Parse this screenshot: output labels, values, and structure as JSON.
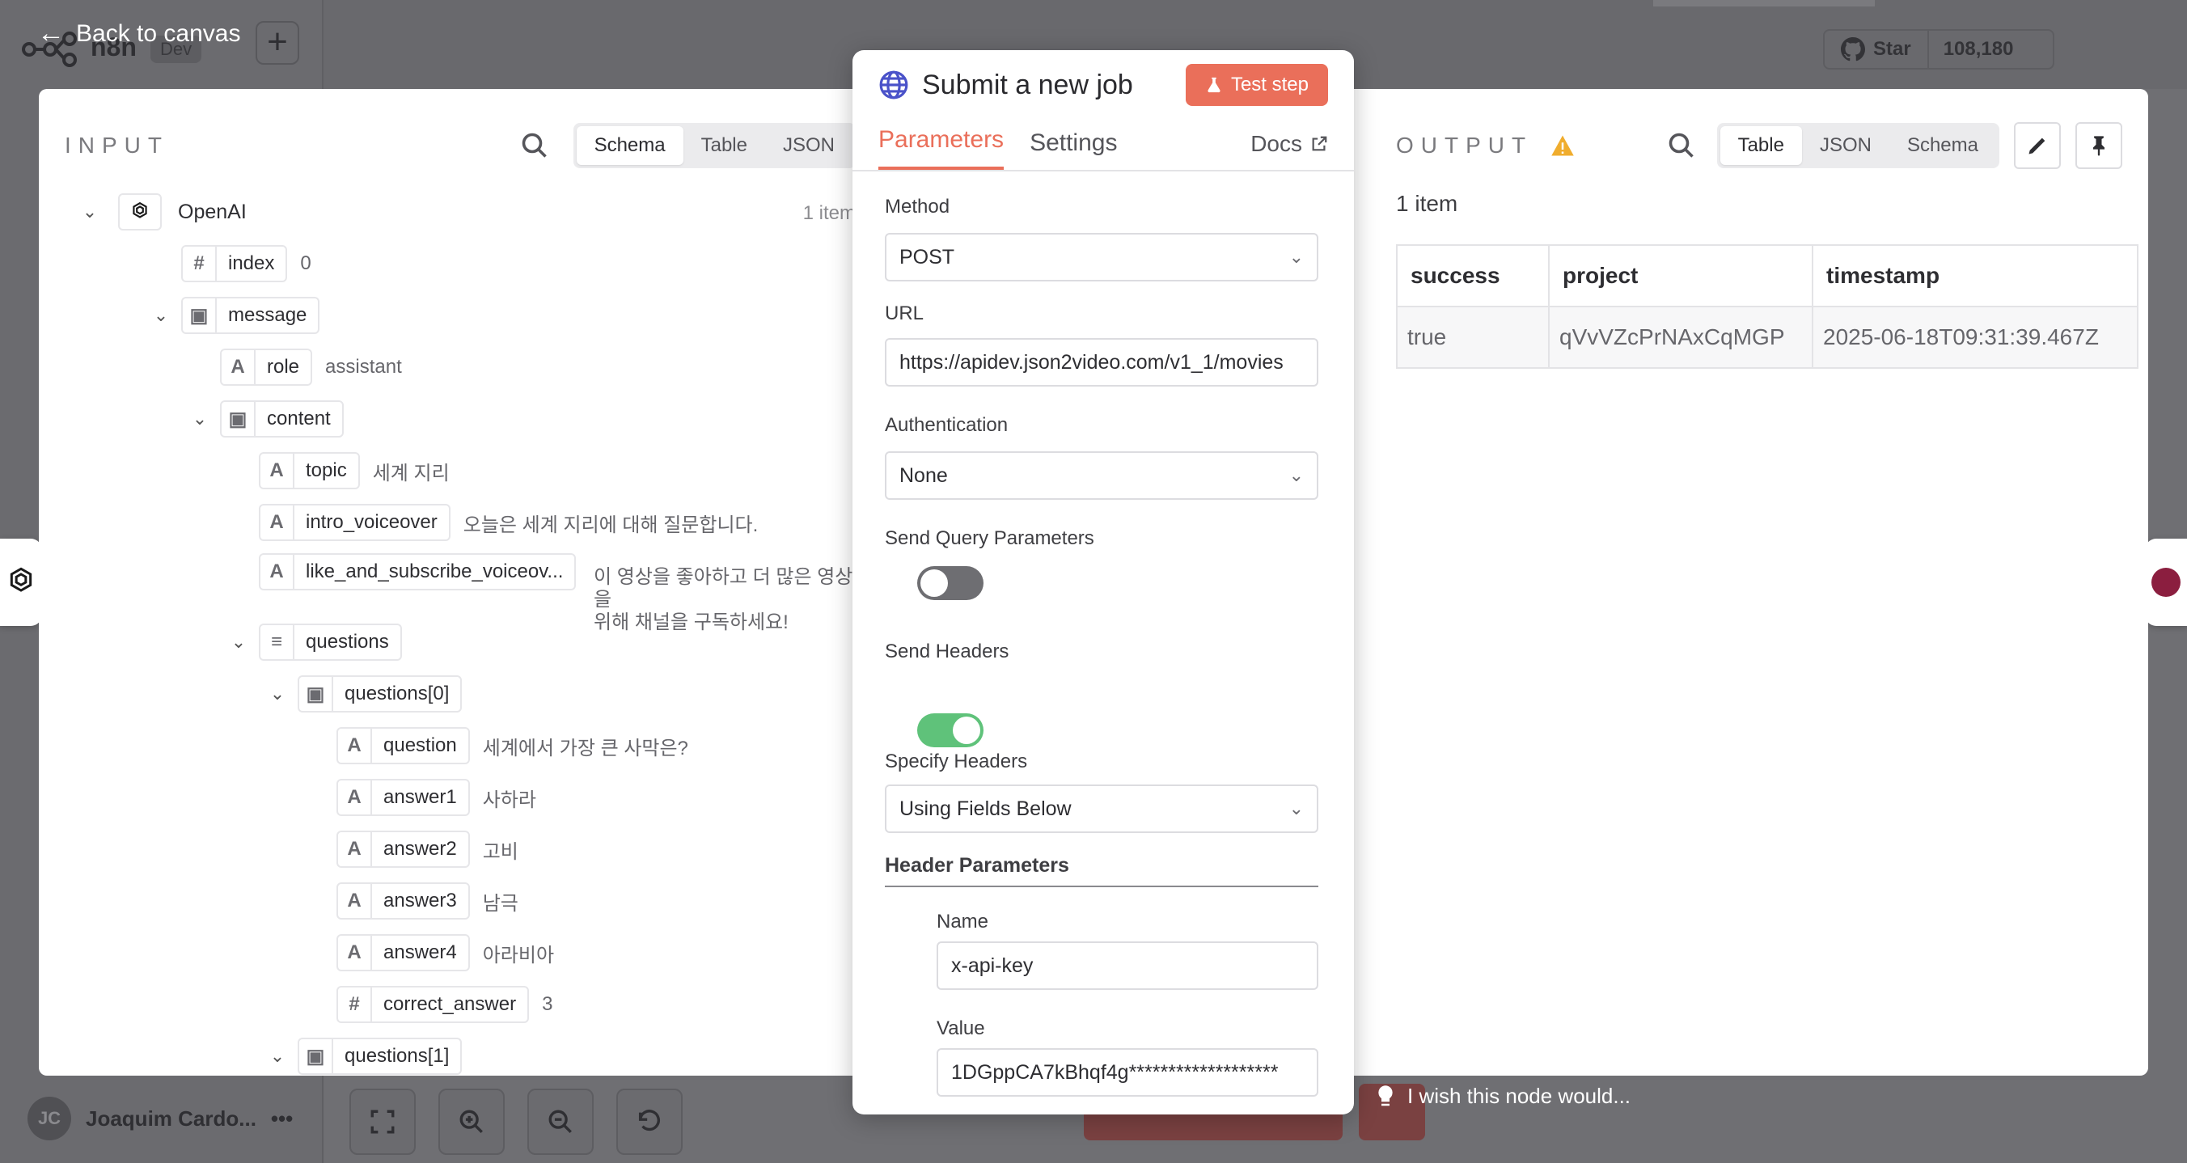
{
  "background": {
    "app_name": "n8n",
    "env_badge": "Dev",
    "github_star": "Star",
    "github_count": "108,180",
    "user_initials": "JC",
    "user_name": "Joaquim Cardo...",
    "user_menu": "•••"
  },
  "back_link": "Back to canvas",
  "input": {
    "title": "INPUT",
    "views": [
      "Schema",
      "Table",
      "JSON"
    ],
    "active_view": "Schema",
    "tree": {
      "root": {
        "name": "OpenAI",
        "count": "1 item"
      },
      "index": {
        "type": "#",
        "name": "index",
        "value": "0"
      },
      "message": {
        "name": "message"
      },
      "role": {
        "type": "A",
        "name": "role",
        "value": "assistant"
      },
      "content": {
        "name": "content"
      },
      "topic": {
        "type": "A",
        "name": "topic",
        "value": "세계 지리"
      },
      "intro": {
        "type": "A",
        "name": "intro_voiceover",
        "value": "오늘은 세계 지리에 대해 질문합니다."
      },
      "like": {
        "type": "A",
        "name": "like_and_subscribe_voiceov...",
        "value_line1": "이 영상을 좋아하고 더 많은 영상을",
        "value_line2": "위해 채널을 구독하세요!"
      },
      "questions": {
        "name": "questions"
      },
      "q0": {
        "name": "questions[0]"
      },
      "question": {
        "type": "A",
        "name": "question",
        "value": "세계에서 가장 큰 사막은?"
      },
      "answer1": {
        "type": "A",
        "name": "answer1",
        "value": "사하라"
      },
      "answer2": {
        "type": "A",
        "name": "answer2",
        "value": "고비"
      },
      "answer3": {
        "type": "A",
        "name": "answer3",
        "value": "남극"
      },
      "answer4": {
        "type": "A",
        "name": "answer4",
        "value": "아라비아"
      },
      "correct": {
        "type": "#",
        "name": "correct_answer",
        "value": "3"
      },
      "q1": {
        "name": "questions[1]"
      }
    }
  },
  "node": {
    "title": "Submit a new job",
    "test_button": "Test step",
    "tabs": {
      "parameters": "Parameters",
      "settings": "Settings",
      "docs": "Docs"
    },
    "method": {
      "label": "Method",
      "value": "POST"
    },
    "url": {
      "label": "URL",
      "value": "https://apidev.json2video.com/v1_1/movies"
    },
    "authentication": {
      "label": "Authentication",
      "value": "None"
    },
    "send_query": {
      "label": "Send Query Parameters",
      "enabled": false
    },
    "send_headers": {
      "label": "Send Headers",
      "enabled": true
    },
    "specify_headers": {
      "label": "Specify Headers",
      "value": "Using Fields Below"
    },
    "header_parameters": {
      "title": "Header Parameters",
      "name_label": "Name",
      "name_value": "x-api-key",
      "value_label": "Value",
      "value_value": "1DGppCA7kBhqf4g*******************"
    }
  },
  "output": {
    "title": "OUTPUT",
    "views": [
      "Table",
      "JSON",
      "Schema"
    ],
    "active_view": "Table",
    "count": "1 item",
    "columns": [
      "success",
      "project",
      "timestamp"
    ],
    "rows": [
      [
        "true",
        "qVvVZcPrNAxCqMGP",
        "2025-06-18T09:31:39.467Z"
      ]
    ]
  },
  "feedback": "I wish this node would...",
  "colors": {
    "accent": "#ea6f5a",
    "toggle_on": "#5fc27a",
    "warning": "#f0ad2e",
    "globe": "#4a52c9"
  }
}
